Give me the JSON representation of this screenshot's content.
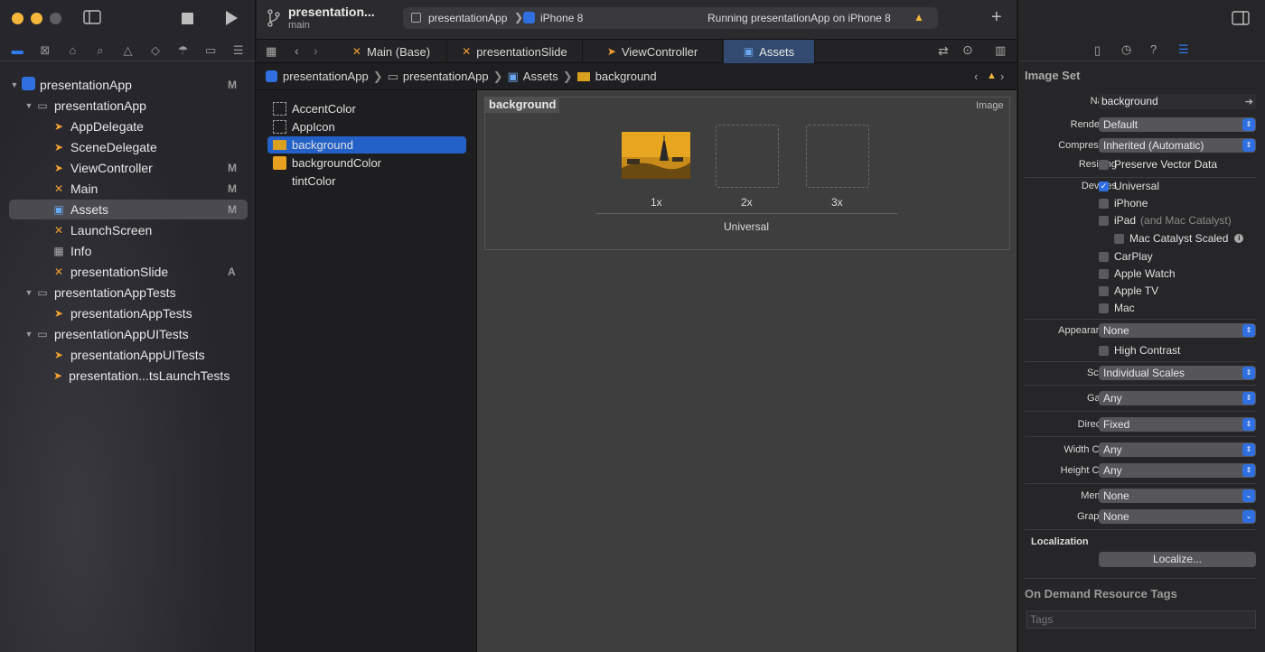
{
  "toolbar": {
    "scheme_title": "presentation...",
    "branch": "main",
    "run_target_app": "presentationApp",
    "run_target_device": "iPhone 8",
    "run_status": "Running presentationApp on iPhone 8"
  },
  "editor_tabs": [
    {
      "label": "Main (Base)"
    },
    {
      "label": "presentationSlide"
    },
    {
      "label": "ViewController"
    },
    {
      "label": "Assets"
    }
  ],
  "jump_bar": [
    "presentationApp",
    "presentationApp",
    "Assets",
    "background"
  ],
  "navigator": [
    {
      "label": "presentationApp",
      "status": "M"
    },
    {
      "label": "presentationApp",
      "status": ""
    },
    {
      "label": "AppDelegate",
      "status": ""
    },
    {
      "label": "SceneDelegate",
      "status": ""
    },
    {
      "label": "ViewController",
      "status": "M"
    },
    {
      "label": "Main",
      "status": "M"
    },
    {
      "label": "Assets",
      "status": "M"
    },
    {
      "label": "LaunchScreen",
      "status": ""
    },
    {
      "label": "Info",
      "status": ""
    },
    {
      "label": "presentationSlide",
      "status": "A"
    },
    {
      "label": "presentationAppTests",
      "status": ""
    },
    {
      "label": "presentationAppTests",
      "status": ""
    },
    {
      "label": "presentationAppUITests",
      "status": ""
    },
    {
      "label": "presentationAppUITests",
      "status": ""
    },
    {
      "label": "presentation...tsLaunchTests",
      "status": ""
    }
  ],
  "assets": [
    {
      "label": "AccentColor"
    },
    {
      "label": "AppIcon"
    },
    {
      "label": "background"
    },
    {
      "label": "backgroundColor"
    },
    {
      "label": "tintColor"
    }
  ],
  "image_set": {
    "name": "background",
    "kind": "Image",
    "slots": [
      "1x",
      "2x",
      "3x"
    ],
    "group": "Universal"
  },
  "inspector": {
    "section_title": "Image Set",
    "name_label": "Name",
    "name_value": "background",
    "render_label": "Render As",
    "render_value": "Default",
    "compression_label": "Compression",
    "compression_value": "Inherited (Automatic)",
    "resizing_label": "Resizing",
    "resizing_value": "Preserve Vector Data",
    "devices_label": "Devices",
    "devices": [
      "Universal",
      "iPhone",
      "iPad",
      "Mac Catalyst Scaled",
      "CarPlay",
      "Apple Watch",
      "Apple TV",
      "Mac"
    ],
    "ipad_suffix": "(and Mac Catalyst)",
    "appearances_label": "Appearances",
    "appearances_value": "None",
    "high_contrast": "High Contrast",
    "scales_label": "Scales",
    "scales_value": "Individual Scales",
    "gamut_label": "Gamut",
    "gamut_value": "Any",
    "direction_label": "Direction",
    "direction_value": "Fixed",
    "width_label": "Width Class",
    "width_value": "Any",
    "height_label": "Height Class",
    "height_value": "Any",
    "memory_label": "Memory",
    "memory_value": "None",
    "graphics_label": "Graphics",
    "graphics_value": "None",
    "localization_title": "Localization",
    "localize_button": "Localize...",
    "odr_title": "On Demand Resource Tags",
    "tags_placeholder": "Tags"
  }
}
